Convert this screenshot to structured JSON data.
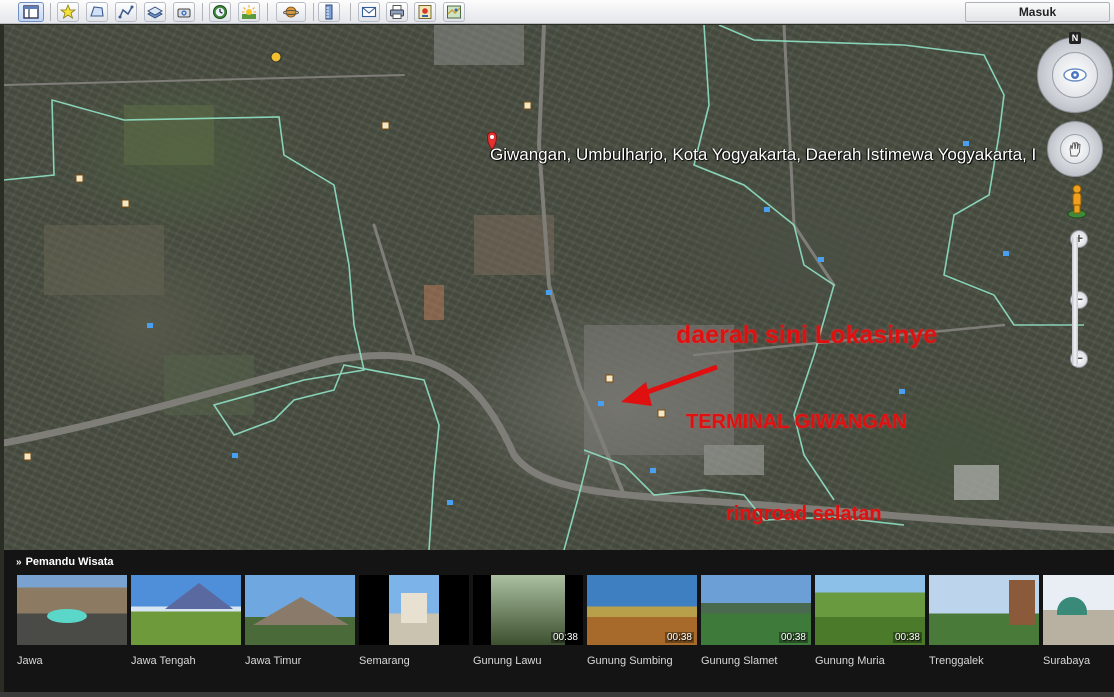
{
  "toolbar": {
    "signin_label": "Masuk",
    "buttons": [
      "sidebar-toggle-icon",
      "add-placemark-icon",
      "add-polygon-icon",
      "add-path-icon",
      "add-image-overlay-icon",
      "record-tour-icon",
      "historical-imagery-icon",
      "sunlight-icon",
      "switch-to-sky-icon",
      "ruler-icon",
      "email-icon",
      "print-icon",
      "save-image-icon",
      "view-in-maps-icon"
    ]
  },
  "map": {
    "location_label": "Giwangan, Umbulharjo, Kota Yogyakarta, Daerah Istimewa Yogyakarta, I",
    "annotation_location": "daerah sini Lokasinye",
    "annotation_terminal": "TERMINAL GIWANGAN",
    "annotation_road": "ringroad selatan",
    "compass_north": "N",
    "zoom_in": "+",
    "zoom_out": "−",
    "colors": {
      "annotation": "#e01010",
      "boundary": "#8fe0c4"
    }
  },
  "tour_guide": {
    "title": "Pemandu Wisata",
    "items": [
      {
        "label": "Jawa",
        "duration": ""
      },
      {
        "label": "Jawa Tengah",
        "duration": ""
      },
      {
        "label": "Jawa Timur",
        "duration": ""
      },
      {
        "label": "Semarang",
        "duration": ""
      },
      {
        "label": "Gunung Lawu",
        "duration": "00:38"
      },
      {
        "label": "Gunung Sumbing",
        "duration": "00:38"
      },
      {
        "label": "Gunung Slamet",
        "duration": "00:38"
      },
      {
        "label": "Gunung Muria",
        "duration": "00:38"
      },
      {
        "label": "Trenggalek",
        "duration": ""
      },
      {
        "label": "Surabaya",
        "duration": ""
      }
    ]
  }
}
